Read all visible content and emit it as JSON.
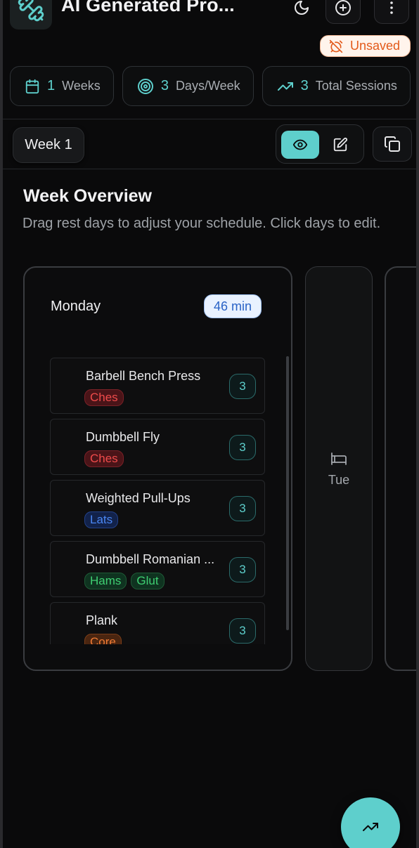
{
  "header": {
    "title": "AI Generated Pro...",
    "status_badge": "Unsaved",
    "icons": [
      "dumbbell-icon",
      "moon-icon",
      "plus-circle-icon",
      "more-vertical-icon"
    ]
  },
  "stats": [
    {
      "value": "1",
      "label": "Weeks",
      "icon": "calendar-icon"
    },
    {
      "value": "3",
      "label": "Days/Week",
      "icon": "target-icon"
    },
    {
      "value": "3",
      "label": "Total Sessions",
      "icon": "trending-up-icon"
    }
  ],
  "week_bar": {
    "selected_week": "Week 1",
    "view_mode": "view",
    "icons": [
      "eye-icon",
      "edit-icon",
      "copy-icon"
    ]
  },
  "overview": {
    "title": "Week Overview",
    "description": "Drag rest days to adjust your schedule. Click days to edit.",
    "days": [
      {
        "name": "Monday",
        "duration": "46 min",
        "exercises": [
          {
            "name": "Barbell Bench Press",
            "tags": [
              "Ches"
            ],
            "sets": "3"
          },
          {
            "name": "Dumbbell Fly",
            "tags": [
              "Ches"
            ],
            "sets": "3"
          },
          {
            "name": "Weighted Pull-Ups",
            "tags": [
              "Lats"
            ],
            "sets": "3"
          },
          {
            "name": "Dumbbell Romanian ...",
            "tags": [
              "Hams",
              "Glut"
            ],
            "sets": "3"
          },
          {
            "name": "Plank",
            "tags": [
              "Core"
            ],
            "sets": "3"
          }
        ]
      },
      {
        "name": "Tue",
        "rest": true,
        "icon": "bed-icon"
      }
    ]
  },
  "colors": {
    "accent": "#5ecfcc",
    "background": "#0a0a0b",
    "unsaved": "#e35a1a",
    "duration_badge": "#2a63c6"
  },
  "fab": {
    "icon": "trending-up-icon"
  }
}
